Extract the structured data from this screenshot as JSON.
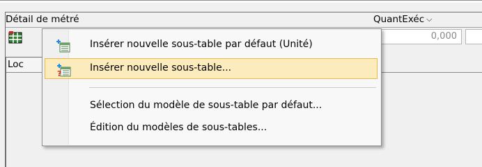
{
  "panel": {
    "title": "Détail de métré",
    "quantity_header": "QuantExéc",
    "quantity_chevron": "✔",
    "quantity_value": "0,000",
    "loc_header": "Loc"
  },
  "menu": {
    "items": [
      {
        "label": "Insérer nouvelle sous-table par défaut (Unité)",
        "icon": "insert-table-icon"
      },
      {
        "label": "Insérer nouvelle sous-table...",
        "icon": "insert-table-question-icon"
      },
      {
        "label": "Sélection du modèle de sous-table par défaut...",
        "icon": ""
      },
      {
        "label": "Édition du modèles de sous-tables...",
        "icon": ""
      }
    ]
  },
  "colors": {
    "highlight_bg": "#fcecbd",
    "highlight_border": "#e5b847",
    "menu_bg": "#f8f8f8"
  }
}
